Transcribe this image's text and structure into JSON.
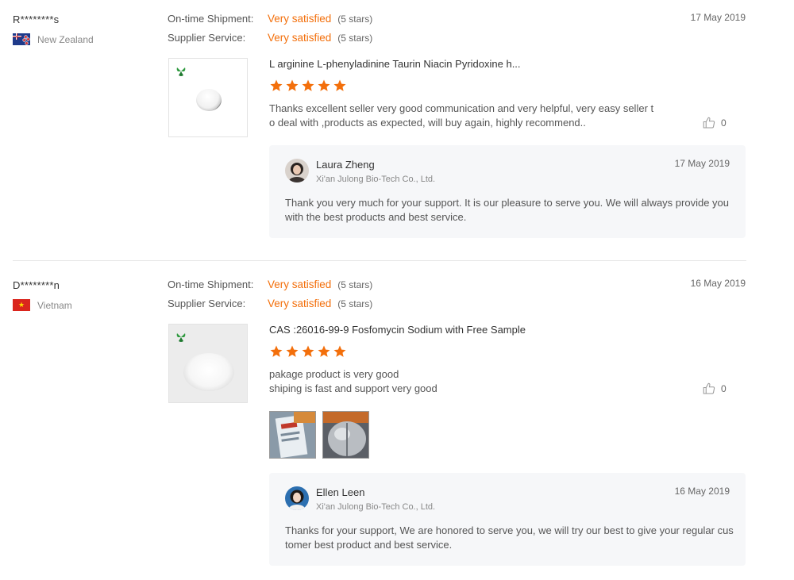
{
  "labels": {
    "ontime": "On-time Shipment:",
    "supplier": "Supplier Service:"
  },
  "colors": {
    "accent": "#f36f0b",
    "reply_bg": "#f6f7f9"
  },
  "reviews": [
    {
      "buyer": "R********s",
      "country": "New Zealand",
      "flag_icon": "new-zealand-flag-icon",
      "ontime_value": "Very satisfied",
      "ontime_stars": "(5 stars)",
      "supplier_value": "Very satisfied",
      "supplier_stars": "(5 stars)",
      "date": "17 May 2019",
      "product_title": "L arginine L-phenyladinine Taurin Niacin Pyridoxine h...",
      "rating": 5,
      "text": "Thanks excellent seller very good communication and very helpful, very easy seller to deal with ,products as expected, will buy again, highly recommend..",
      "likes": "0",
      "reply": {
        "name": "Laura Zheng",
        "company": "Xi'an Julong Bio-Tech Co., Ltd.",
        "date": "17 May 2019",
        "text": "Thank you very much for your support. It is our pleasure to serve you. We will always provide you with the best products and best service."
      }
    },
    {
      "buyer": "D********n",
      "country": "Vietnam",
      "flag_icon": "vietnam-flag-icon",
      "ontime_value": "Very satisfied",
      "ontime_stars": "(5 stars)",
      "supplier_value": "Very satisfied",
      "supplier_stars": "(5 stars)",
      "date": "16 May 2019",
      "product_title": "CAS :26016-99-9 Fosfomycin Sodium with Free Sample",
      "rating": 5,
      "text_line1": "pakage product is very good",
      "text_line2": "shiping is fast and support very good",
      "likes": "0",
      "reply": {
        "name": "Ellen Leen",
        "company": "Xi'an Julong Bio-Tech Co., Ltd.",
        "date": "16 May 2019",
        "text": "Thanks for your support, We are honored to serve you, we will try our best to give your regular customer best product and best service."
      }
    }
  ]
}
